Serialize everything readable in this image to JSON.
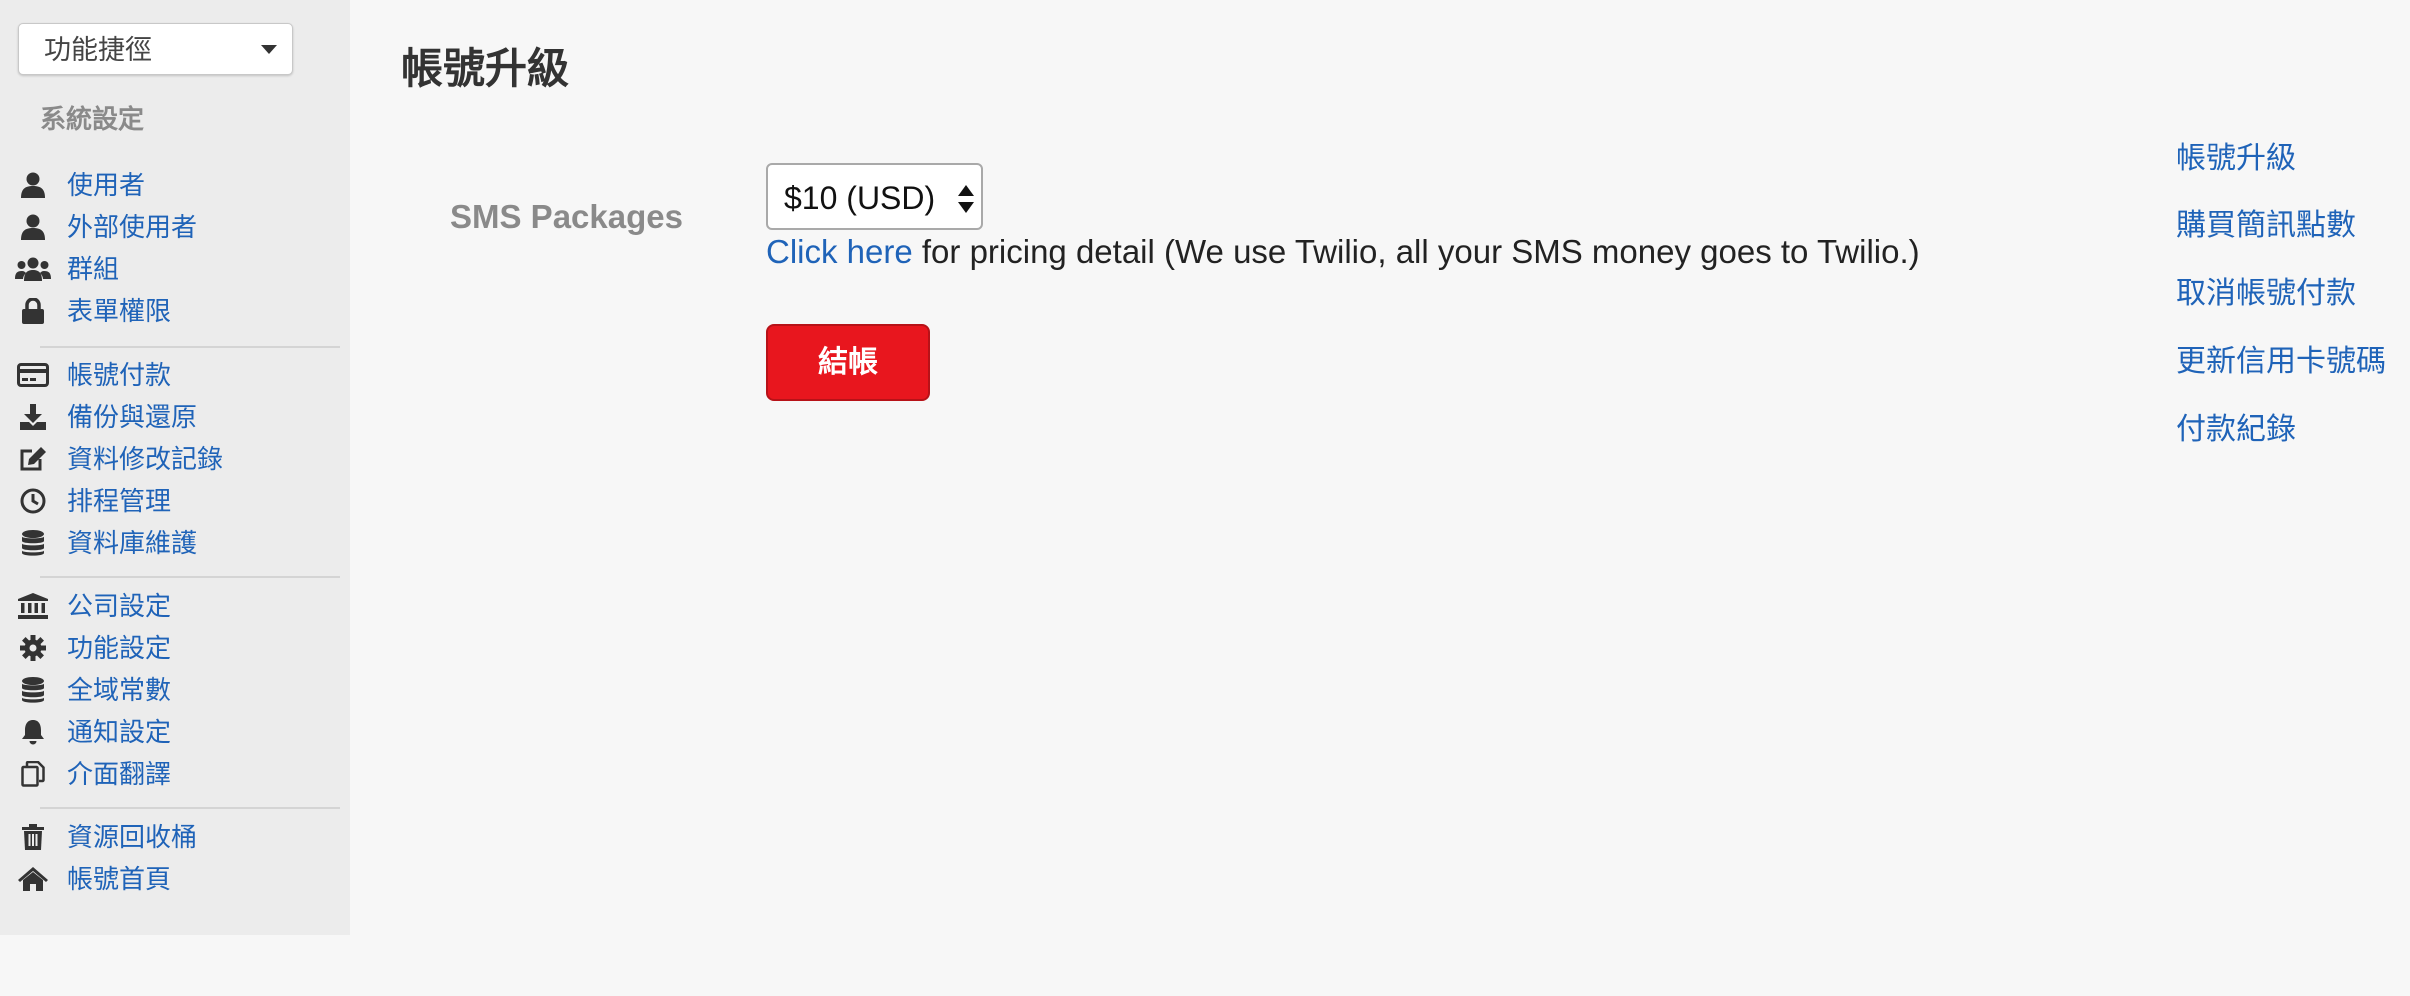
{
  "sidebar": {
    "shortcut_label": "功能捷徑",
    "section_title": "系統設定",
    "items": [
      {
        "label": "使用者",
        "icon": "user-icon"
      },
      {
        "label": "外部使用者",
        "icon": "user-icon"
      },
      {
        "label": "群組",
        "icon": "users-icon"
      },
      {
        "label": "表單權限",
        "icon": "lock-icon"
      },
      {
        "label": "帳號付款",
        "icon": "credit-card-icon"
      },
      {
        "label": "備份與還原",
        "icon": "download-icon"
      },
      {
        "label": "資料修改記錄",
        "icon": "edit-icon"
      },
      {
        "label": "排程管理",
        "icon": "clock-icon"
      },
      {
        "label": "資料庫維護",
        "icon": "database-icon"
      },
      {
        "label": "公司設定",
        "icon": "bank-icon"
      },
      {
        "label": "功能設定",
        "icon": "gear-icon"
      },
      {
        "label": "全域常數",
        "icon": "database-icon"
      },
      {
        "label": "通知設定",
        "icon": "bell-icon"
      },
      {
        "label": "介面翻譯",
        "icon": "copy-icon"
      },
      {
        "label": "資源回收桶",
        "icon": "trash-icon"
      },
      {
        "label": "帳號首頁",
        "icon": "home-icon"
      }
    ]
  },
  "main": {
    "title": "帳號升級",
    "sms_label": "SMS Packages",
    "package_selected": "$10 (USD)",
    "pricing_link": "Click here",
    "pricing_text": " for pricing detail (We use Twilio, all your SMS money goes to Twilio.)",
    "checkout_label": "結帳"
  },
  "right_nav": [
    {
      "label": "帳號升級"
    },
    {
      "label": "購買簡訊點數"
    },
    {
      "label": "取消帳號付款"
    },
    {
      "label": "更新信用卡號碼"
    },
    {
      "label": "付款紀錄"
    }
  ],
  "colors": {
    "link": "#1f63b8",
    "checkout_button": "#e8161e",
    "sidebar_background": "#ececec",
    "page_background": "#f7f7f7"
  }
}
